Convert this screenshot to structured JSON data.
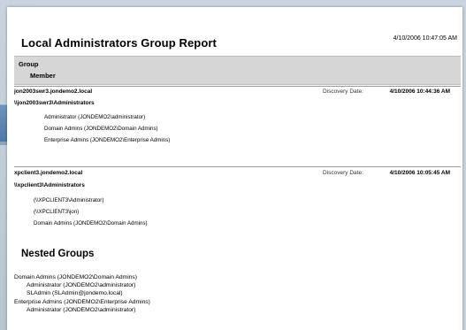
{
  "report": {
    "title": "Local Administrators Group Report",
    "timestamp": "4/10/2006 10:47:05 AM",
    "header": {
      "group": "Group",
      "member": "Member"
    }
  },
  "servers": [
    {
      "name": "jon2003swr3.jondemo2.local",
      "discovery_label": "Discovery Date:",
      "discovery_date": "4/10/2006 10:44:36 AM",
      "group": "\\\\jon2003swr3\\Administrators",
      "members": [
        "Administrator (JONDEMO2\\administrator)",
        "Domain Admins (JONDEMO2\\Domain Admins)",
        "Enterprise Admins (JONDEMO2\\Enterprise Admins)"
      ]
    },
    {
      "name": "xpclient3.jondemo2.local",
      "discovery_label": "Discovery Date:",
      "discovery_date": "4/10/2006 10:05:45 AM",
      "group": "\\\\xpclient3\\Administrators",
      "members": [
        "(\\\\XPCLIENT3\\Administrator)",
        "(\\\\XPCLIENT3\\jon)",
        "Domain Admins (JONDEMO2\\Domain Admins)"
      ]
    }
  ],
  "nested": {
    "title": "Nested Groups",
    "lines": [
      "Domain Admins (JONDEMO2\\Domain Admins)",
      "Administrator (JONDEMO2\\administrator)",
      "SLAdmin (SLAdmin@jondemo.local)",
      "Enterprise Admins (JONDEMO2\\Enterprise Admins)",
      "Administrator (JONDEMO2\\administrator)"
    ]
  }
}
